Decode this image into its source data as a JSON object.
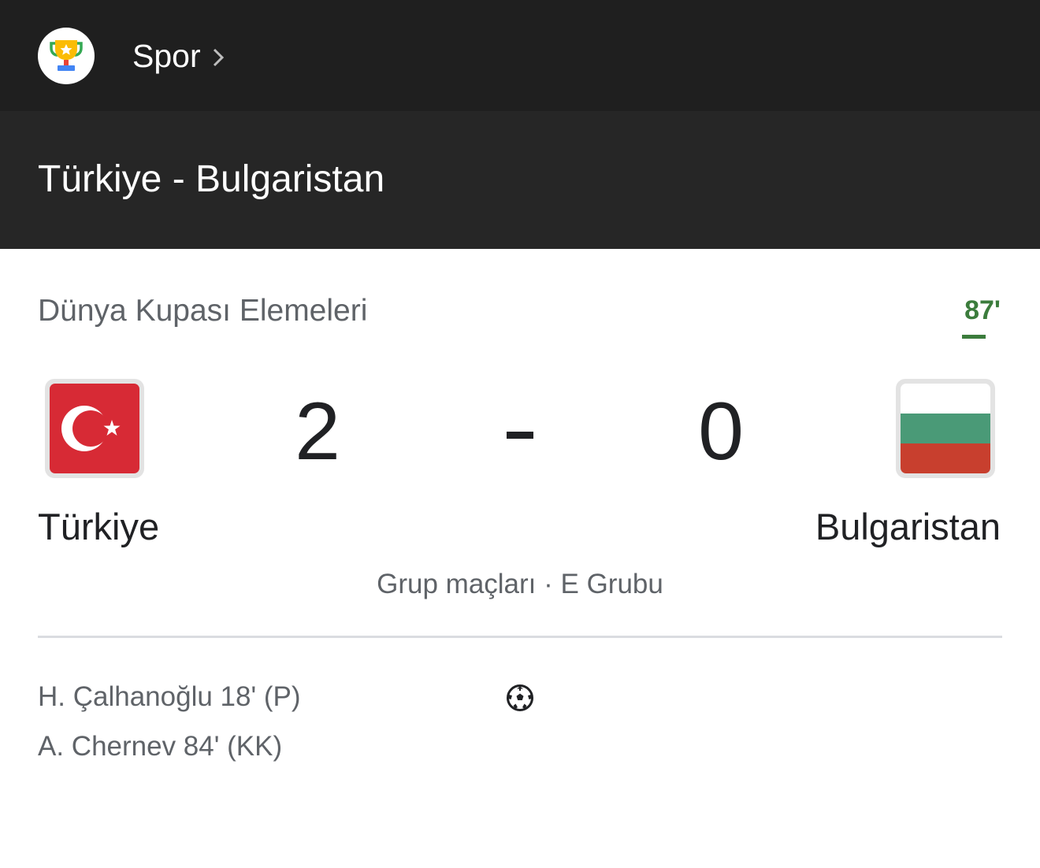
{
  "header": {
    "icon": "trophy-icon",
    "breadcrumb_label": "Spor"
  },
  "match": {
    "title": "Türkiye - Bulgaristan",
    "competition": "Dünya Kupası Elemeleri",
    "minute": "87'",
    "status_color": "#3b7c3c",
    "home": {
      "name": "Türkiye",
      "score": "2",
      "flag": "turkey-flag-icon"
    },
    "away": {
      "name": "Bulgaristan",
      "score": "0",
      "flag": "bulgaria-flag-icon"
    },
    "stage": "Grup maçları · E Grubu",
    "goals": [
      {
        "text": "H. Çalhanoğlu 18' (P)",
        "icon": "soccer-ball-icon"
      },
      {
        "text": "A. Chernev 84' (KK)"
      }
    ]
  }
}
